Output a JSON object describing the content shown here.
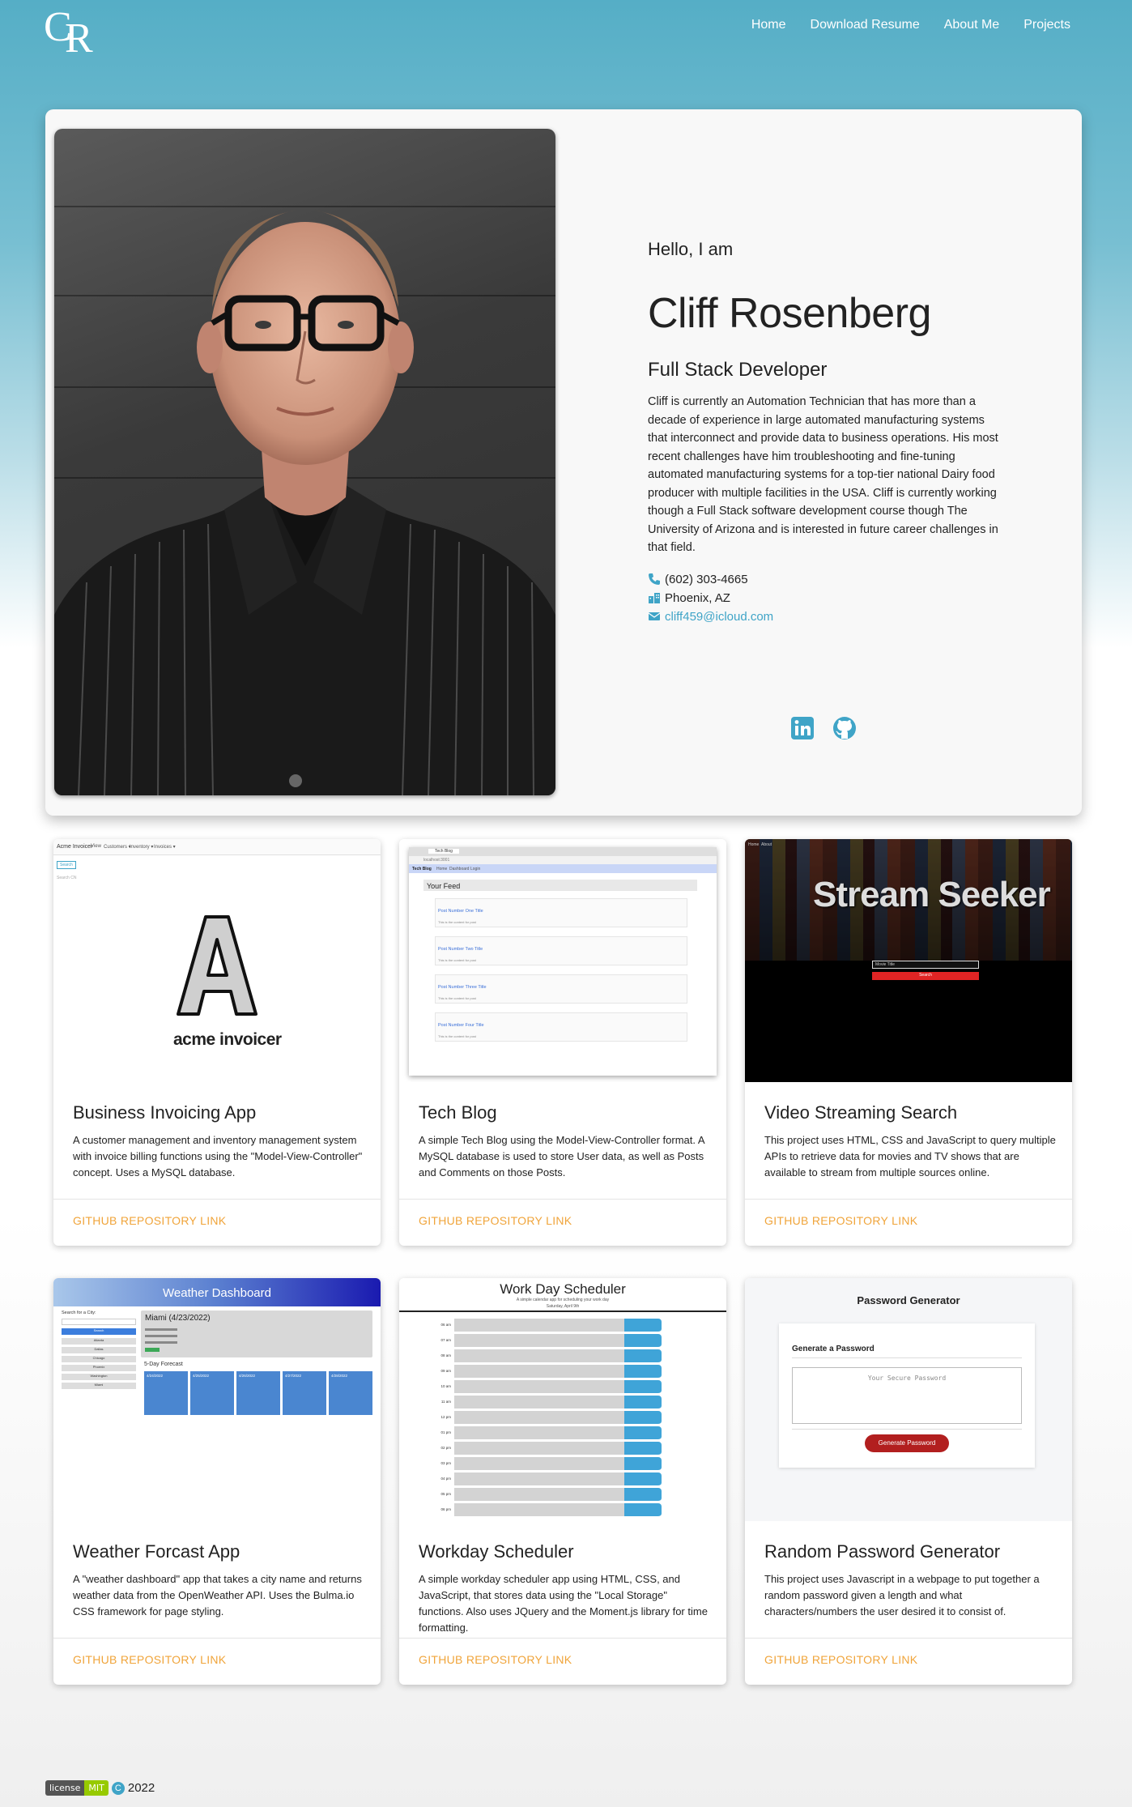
{
  "nav": {
    "logo_c": "C",
    "logo_r": "R",
    "links": [
      "Home",
      "Download Resume",
      "About Me",
      "Projects"
    ]
  },
  "hero": {
    "greeting": "Hello, I am",
    "name": "Cliff Rosenberg",
    "role": "Full Stack Developer",
    "bio": "Cliff is currently an Automation Technician that has more than a decade of experience in large automated manufacturing systems that interconnect and provide data to business operations. His most recent challenges have him troubleshooting and fine-tuning automated manufacturing systems for a top-tier national Dairy food producer with multiple facilities in the USA. Cliff is currently working though a Full Stack software development course though The University of Arizona and is interested in future career challenges in that field.",
    "phone": "(602) 303-4665",
    "location": "Phoenix, AZ",
    "email": "cliff459@icloud.com",
    "social": [
      "linkedin-icon",
      "github-icon"
    ]
  },
  "projects": [
    {
      "title": "Business Invoicing App",
      "desc": "A customer management and inventory management system with invoice billing functions using the \"Model-View-Controller\" concept. Uses a MySQL database.",
      "link": "GITHUB REPOSITORY LINK",
      "thumb": {
        "brand": "Acme Invoicer",
        "menu": [
          "View",
          "Customers ▾",
          "Inventory ▾",
          "Invoices ▾"
        ],
        "btn": "Search",
        "sub": "Search CN",
        "logo_letter": "A",
        "logo_text": "acme invoicer"
      }
    },
    {
      "title": "Tech Blog",
      "desc": "A simple Tech Blog using the Model-View-Controller format. A MySQL database is used to store User data, as well as Posts and Comments on those Posts.",
      "link": "GITHUB REPOSITORY LINK",
      "thumb": {
        "tab": "Tech Blog",
        "url": "localhost:3001",
        "nav_brand": "Tech Blog",
        "nav": [
          "Home",
          "Dashboard",
          "Login"
        ],
        "feed": "Your Feed",
        "posts": [
          "Post Number One Title",
          "Post Number Two Title",
          "Post Number Three Title",
          "Post Number Four Title"
        ],
        "post_body": "This is the content for post"
      }
    },
    {
      "title": "Video Streaming Search",
      "desc": "This project uses HTML, CSS and JavaScript to query multiple APIs to retrieve data for movies and TV shows that are available to stream from multiple sources online.",
      "link": "GITHUB REPOSITORY LINK",
      "thumb": {
        "nav": [
          "Home",
          "About"
        ],
        "heading": "Stream Seeker",
        "placeholder": "Movie Title",
        "btn": "Search"
      }
    },
    {
      "title": "Weather Forcast App",
      "desc": "A \"weather dashboard\" app that takes a city name and returns weather data from the OpenWeather API. Uses the Bulma.io CSS framework for page styling.",
      "link": "GITHUB REPOSITORY LINK",
      "thumb": {
        "header": "Weather Dashboard",
        "search_label": "Search for a City:",
        "btn": "Search",
        "cities": [
          "Atlanta",
          "Dallas",
          "Chicago",
          "Phoenix",
          "Washington",
          "Miami"
        ],
        "city": "Miami (4/23/2022)",
        "forecast_label": "5-Day Forecast",
        "days": [
          "4/24/2022",
          "4/25/2022",
          "4/26/2022",
          "4/27/2022",
          "4/28/2022"
        ]
      }
    },
    {
      "title": "Workday Scheduler",
      "desc": "A simple workday scheduler app using HTML, CSS, and JavaScript, that stores data using the \"Local Storage\" functions. Also uses JQuery and the Moment.js library for time formatting.",
      "link": "GITHUB REPOSITORY LINK",
      "thumb": {
        "heading": "Work Day Scheduler",
        "sub": "A simple calendar app for scheduling your work day",
        "date": "Saturday, April 9th",
        "hours": [
          "06 am",
          "07 am",
          "08 am",
          "09 am",
          "10 am",
          "11 am",
          "12 pm",
          "01 pm",
          "02 pm",
          "03 pm",
          "04 pm",
          "05 pm",
          "06 pm"
        ]
      }
    },
    {
      "title": "Random Password Generator",
      "desc": "This project uses Javascript in a webpage to put together a random password given a length and what characters/numbers the user desired it to consist of.",
      "link": "GITHUB REPOSITORY LINK",
      "thumb": {
        "heading": "Password Generator",
        "card_title": "Generate a Password",
        "placeholder": "Your Secure Password",
        "btn": "Generate Password"
      }
    }
  ],
  "footer": {
    "badge_label": "license",
    "badge_value": "MIT",
    "copyright_symbol": "C",
    "year": "2022"
  },
  "colors": {
    "accent": "#3fa4c7",
    "link_orange": "#f0a43a",
    "header_teal": "#55aec6"
  }
}
